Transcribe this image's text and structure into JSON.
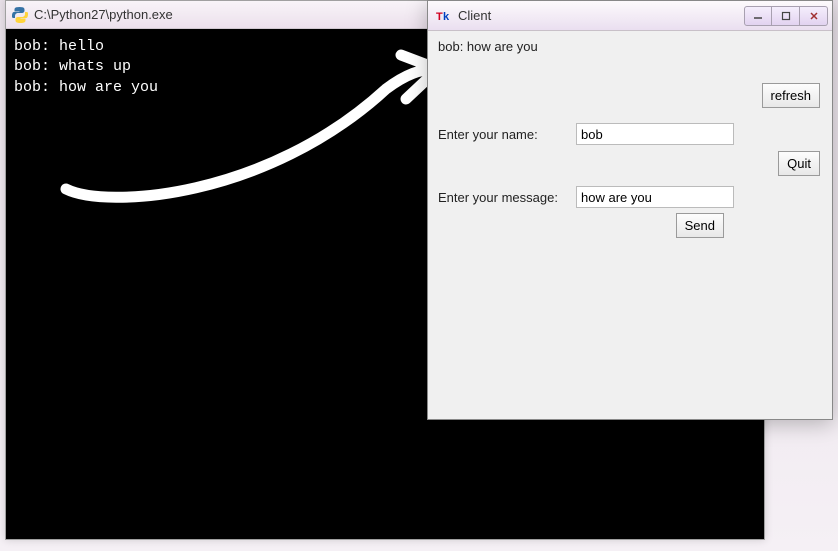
{
  "console": {
    "title": "C:\\Python27\\python.exe",
    "lines": [
      "bob: hello",
      "bob: whats up",
      "bob: how are you"
    ]
  },
  "client": {
    "title": "Client",
    "display_text": "bob: how are you",
    "buttons": {
      "refresh": "refresh",
      "quit": "Quit",
      "send": "Send"
    },
    "labels": {
      "name": "Enter your name:",
      "message": "Enter your message:"
    },
    "inputs": {
      "name_value": "bob",
      "message_value": "how are you"
    },
    "window_controls": {
      "minimize": "minimize",
      "maximize": "maximize",
      "close": "close"
    }
  }
}
